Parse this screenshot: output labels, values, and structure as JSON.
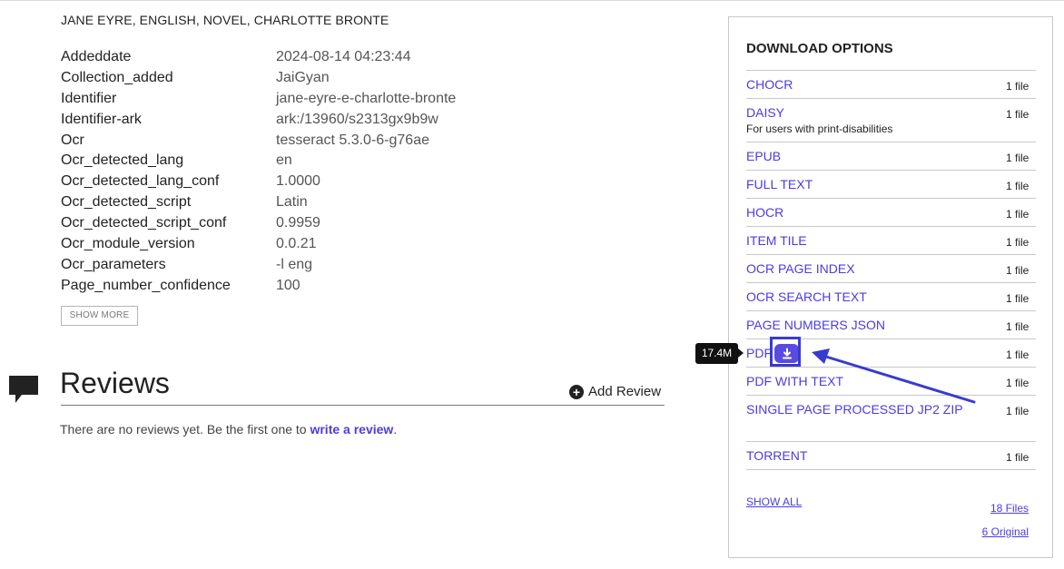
{
  "subjects": "JANE EYRE, ENGLISH, NOVEL, CHARLOTTE BRONTE",
  "metadata": [
    {
      "key": "Addeddate",
      "value": "2024-08-14 04:23:44"
    },
    {
      "key": "Collection_added",
      "value": "JaiGyan"
    },
    {
      "key": "Identifier",
      "value": "jane-eyre-e-charlotte-bronte"
    },
    {
      "key": "Identifier-ark",
      "value": "ark:/13960/s2313gx9b9w"
    },
    {
      "key": "Ocr",
      "value": "tesseract 5.3.0-6-g76ae"
    },
    {
      "key": "Ocr_detected_lang",
      "value": "en"
    },
    {
      "key": "Ocr_detected_lang_conf",
      "value": "1.0000"
    },
    {
      "key": "Ocr_detected_script",
      "value": "Latin"
    },
    {
      "key": "Ocr_detected_script_conf",
      "value": "0.9959"
    },
    {
      "key": "Ocr_module_version",
      "value": "0.0.21"
    },
    {
      "key": "Ocr_parameters",
      "value": "-l eng"
    },
    {
      "key": "Page_number_confidence",
      "value": "100"
    }
  ],
  "show_more_label": "SHOW MORE",
  "reviews": {
    "title": "Reviews",
    "add_review_label": "Add Review",
    "empty_text": "There are no reviews yet. Be the first one to ",
    "write_review_link": "write a review",
    "empty_text_end": "."
  },
  "download": {
    "title": "DOWNLOAD OPTIONS",
    "items": [
      {
        "label": "CHOCR",
        "count": "1 file"
      },
      {
        "label": "DAISY",
        "count": "1 file",
        "sub": "For users with print-disabilities"
      },
      {
        "label": "EPUB",
        "count": "1 file"
      },
      {
        "label": "FULL TEXT",
        "count": "1 file"
      },
      {
        "label": "HOCR",
        "count": "1 file"
      },
      {
        "label": "ITEM TILE",
        "count": "1 file"
      },
      {
        "label": "OCR PAGE INDEX",
        "count": "1 file"
      },
      {
        "label": "OCR SEARCH TEXT",
        "count": "1 file"
      },
      {
        "label": "PAGE NUMBERS JSON",
        "count": "1 file"
      },
      {
        "label": "PDF",
        "count": "1 file"
      },
      {
        "label": "PDF WITH TEXT",
        "count": "1 file"
      },
      {
        "label": "SINGLE PAGE PROCESSED JP2 ZIP",
        "count": "1 file"
      },
      {
        "label": "TORRENT",
        "count": "1 file"
      }
    ],
    "show_all_label": "SHOW ALL",
    "total_files": "18 Files",
    "original_files": "6 Original",
    "pdf_size_tooltip": "17.4M"
  },
  "colors": {
    "link": "#4b3ce0",
    "annotation": "#3a3ad0"
  }
}
